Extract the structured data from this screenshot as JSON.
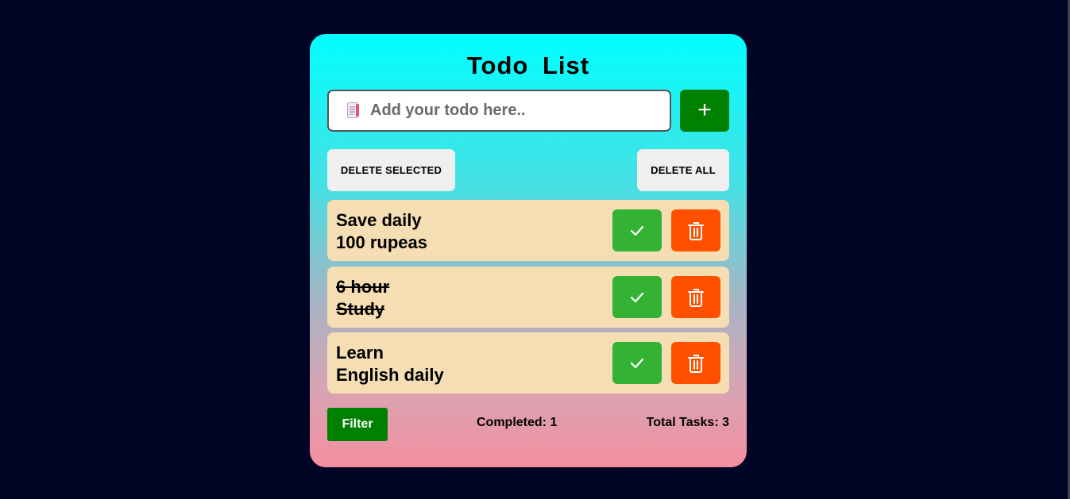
{
  "app": {
    "title": "Todo  List"
  },
  "input": {
    "placeholder": "Add your todo here..",
    "value": "",
    "icon": "notepad-icon"
  },
  "add_button": {
    "label": "+"
  },
  "actions": {
    "delete_selected": "DELETE SELECTED",
    "delete_all": "DELETE ALL"
  },
  "todos": [
    {
      "lines": [
        "Save daily",
        "100 rupeas"
      ],
      "completed": false
    },
    {
      "lines": [
        "6 hour",
        "Study"
      ],
      "completed": true
    },
    {
      "lines": [
        "Learn",
        "English daily"
      ],
      "completed": false
    }
  ],
  "footer": {
    "filter_label": "Filter",
    "completed_text": "Completed: 1",
    "total_text": "Total Tasks: 3"
  },
  "colors": {
    "background": "#020425",
    "gradient_top": "#00ffff",
    "gradient_bottom": "#f48fa0",
    "add_button": "#008000",
    "check_button": "#33b233",
    "delete_button": "#ff5000",
    "todo_item": "#f5deb3",
    "action_button": "#efefef"
  }
}
